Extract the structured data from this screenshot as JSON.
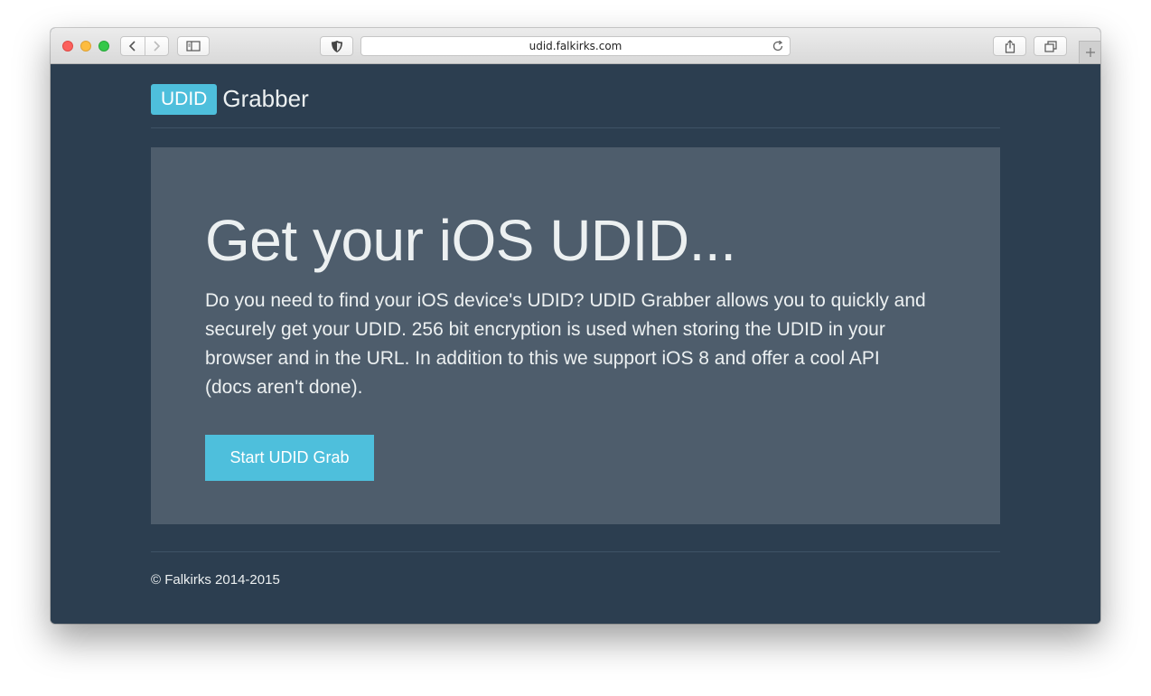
{
  "browser": {
    "url": "udid.falkirks.com"
  },
  "header": {
    "brand_badge": "UDID",
    "brand_text": "Grabber"
  },
  "hero": {
    "title": "Get your iOS UDID...",
    "description": "Do you need to find your iOS device's UDID? UDID Grabber allows you to quickly and securely get your UDID. 256 bit encryption is used when storing the UDID in your browser and in the URL. In addition to this we support iOS 8 and offer a cool API (docs aren't done).",
    "button_label": "Start UDID Grab"
  },
  "footer": {
    "copyright": "© Falkirks 2014-2015"
  },
  "colors": {
    "page_background": "#2c3e50",
    "jumbotron_background": "#4e5d6c",
    "accent": "#4ebfdc",
    "text": "#ecf0f1"
  },
  "icons": {
    "back": "chevron-left-icon",
    "forward": "chevron-right-icon",
    "sidebar": "sidebar-icon",
    "shield": "shield-icon",
    "reload": "reload-icon",
    "share": "share-icon",
    "tabs": "tabs-icon",
    "new_tab": "plus-icon"
  }
}
